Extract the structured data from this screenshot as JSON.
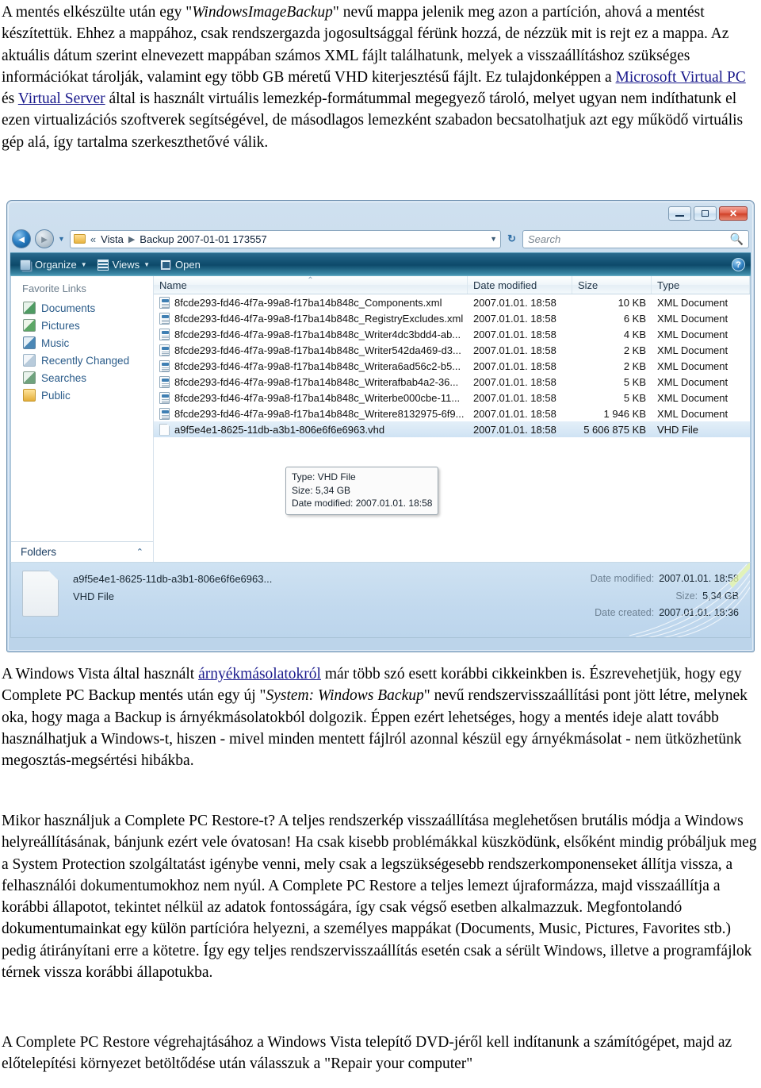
{
  "article": {
    "para1_parts": [
      {
        "t": "A mentés elkészülte után egy \"",
        "s": "n"
      },
      {
        "t": "WindowsImageBackup",
        "s": "i"
      },
      {
        "t": "\" nevű mappa jelenik meg azon a partíción, ahová a mentést készítettük. Ehhez a mappához, csak rendszergazda jogosultsággal férünk hozzá, de nézzük mit is rejt ez a mappa. Az aktuális dátum szerint elnevezett mappában számos XML fájlt találhatunk, melyek a visszaállításhoz szükséges információkat tárolják, valamint egy több GB méretű VHD kiterjesztésű fájlt. Ez tulajdonképpen a ",
        "s": "n"
      },
      {
        "t": "Microsoft Virtual PC",
        "s": "a"
      },
      {
        "t": " és ",
        "s": "n"
      },
      {
        "t": "Virtual Server",
        "s": "a"
      },
      {
        "t": " által is használt virtuális lemezkép-formátummal megegyező tároló, melyet ugyan nem indíthatunk el ezen virtualizációs szoftverek segítségével, de másodlagos lemezként szabadon becsatolhatjuk azt egy működő virtuális gép alá, így tartalma szerkeszthetővé válik.",
        "s": "n"
      }
    ],
    "para2_parts": [
      {
        "t": "A Windows Vista által használt ",
        "s": "n"
      },
      {
        "t": "árnyékmásolatokról",
        "s": "a"
      },
      {
        "t": " már több szó esett korábbi cikkeinkben is. Észrevehetjük, hogy egy Complete PC Backup mentés után egy új \"",
        "s": "n"
      },
      {
        "t": "System: Windows Backup",
        "s": "i"
      },
      {
        "t": "\" nevű rendszervisszaállítási pont jött létre, melynek oka, hogy maga a Backup is árnyékmásolatokból dolgozik. Éppen ezért lehetséges, hogy a mentés ideje alatt tovább használhatjuk a Windows-t, hiszen - mivel minden mentett fájlról azonnal készül egy árnyékmásolat - nem ütközhetünk megosztás-megsértési hibákba.",
        "s": "n"
      }
    ],
    "para3": "Mikor használjuk a Complete PC Restore-t? A teljes rendszerkép visszaállítása meglehetősen brutális módja a Windows helyreállításának, bánjunk ezért vele óvatosan! Ha csak kisebb problémákkal küszködünk, elsőként mindig próbáljuk meg a System Protection szolgáltatást igénybe venni, mely csak a legszükségesebb rendszerkomponenseket állítja vissza, a felhasználói dokumentumokhoz nem nyúl. A Complete PC Restore a teljes lemezt újraformázza, majd visszaállítja a korábbi állapotot, tekintet nélkül az adatok fontosságára, így csak végső esetben alkalmazzuk. Megfontolandó dokumentumainkat egy külön partícióra helyezni, a személyes mappákat (Documents, Music, Pictures, Favorites stb.) pedig átirányítani erre a kötetre. Így egy teljes rendszervisszaállítás esetén csak a sérült Windows, illetve a programfájlok térnek vissza korábbi állapotukba.",
    "para4": "A Complete PC Restore végrehajtásához a Windows Vista telepítő DVD-jéről kell indítanunk a számítógépet, majd az előtelepítési környezet betöltődése után válasszuk a \"Repair your computer\""
  },
  "explorer": {
    "window_buttons": {
      "minimize": "minimize-icon",
      "maximize": "maximize-icon",
      "close": "✕"
    },
    "nav": {
      "back": "◄",
      "forward": "►",
      "history_caret": "▼"
    },
    "address": {
      "folder_icon": "folder-icon",
      "overflow": "«",
      "crumbs": [
        "Vista",
        "Backup 2007-01-01 173557"
      ],
      "separator": "▶",
      "dropdown_caret": "▼",
      "refresh_icon": "↻"
    },
    "search": {
      "placeholder": "Search",
      "icon": "🔍"
    },
    "toolbar": {
      "organize": "Organize",
      "views": "Views",
      "open": "Open",
      "caret": "▼",
      "help": "?"
    },
    "nav_pane": {
      "title": "Favorite Links",
      "items": [
        {
          "label": "Documents",
          "icon": "documents-icon"
        },
        {
          "label": "Pictures",
          "icon": "pictures-icon"
        },
        {
          "label": "Music",
          "icon": "music-icon"
        },
        {
          "label": "Recently Changed",
          "icon": "recently-changed-icon"
        },
        {
          "label": "Searches",
          "icon": "searches-icon"
        },
        {
          "label": "Public",
          "icon": "public-folder-icon"
        }
      ],
      "folders_label": "Folders",
      "folders_chevron": "⌃"
    },
    "columns": [
      "Name",
      "Date modified",
      "Size",
      "Type"
    ],
    "sort_indicator": "⌃",
    "files": [
      {
        "name": "8fcde293-fd46-4f7a-99a8-f17ba14b848c_Components.xml",
        "date": "2007.01.01. 18:58",
        "size": "10 KB",
        "type": "XML Document",
        "icon": "xml-file-icon",
        "selected": false
      },
      {
        "name": "8fcde293-fd46-4f7a-99a8-f17ba14b848c_RegistryExcludes.xml",
        "date": "2007.01.01. 18:58",
        "size": "6 KB",
        "type": "XML Document",
        "icon": "xml-file-icon",
        "selected": false
      },
      {
        "name": "8fcde293-fd46-4f7a-99a8-f17ba14b848c_Writer4dc3bdd4-ab...",
        "date": "2007.01.01. 18:58",
        "size": "4 KB",
        "type": "XML Document",
        "icon": "xml-file-icon",
        "selected": false
      },
      {
        "name": "8fcde293-fd46-4f7a-99a8-f17ba14b848c_Writer542da469-d3...",
        "date": "2007.01.01. 18:58",
        "size": "2 KB",
        "type": "XML Document",
        "icon": "xml-file-icon",
        "selected": false
      },
      {
        "name": "8fcde293-fd46-4f7a-99a8-f17ba14b848c_Writera6ad56c2-b5...",
        "date": "2007.01.01. 18:58",
        "size": "2 KB",
        "type": "XML Document",
        "icon": "xml-file-icon",
        "selected": false
      },
      {
        "name": "8fcde293-fd46-4f7a-99a8-f17ba14b848c_Writerafbab4a2-36...",
        "date": "2007.01.01. 18:58",
        "size": "5 KB",
        "type": "XML Document",
        "icon": "xml-file-icon",
        "selected": false
      },
      {
        "name": "8fcde293-fd46-4f7a-99a8-f17ba14b848c_Writerbe000cbe-11...",
        "date": "2007.01.01. 18:58",
        "size": "5 KB",
        "type": "XML Document",
        "icon": "xml-file-icon",
        "selected": false
      },
      {
        "name": "8fcde293-fd46-4f7a-99a8-f17ba14b848c_Writere8132975-6f9...",
        "date": "2007.01.01. 18:58",
        "size": "1 946 KB",
        "type": "XML Document",
        "icon": "xml-file-icon",
        "selected": false
      },
      {
        "name": "a9f5e4e1-8625-11db-a3b1-806e6f6e6963.vhd",
        "date": "2007.01.01. 18:58",
        "size": "5 606 875 KB",
        "type": "VHD File",
        "icon": "vhd-file-icon",
        "selected": true
      }
    ],
    "tooltip": {
      "line1": "Type: VHD File",
      "line2": "Size: 5,34 GB",
      "line3": "Date modified: 2007.01.01. 18:58"
    },
    "details_pane": {
      "file_name": "a9f5e4e1-8625-11db-a3b1-806e6f6e6963...",
      "file_type": "VHD File",
      "date_modified_key": "Date modified:",
      "date_modified_value": "2007.01.01. 18:58",
      "size_key": "Size:",
      "size_value": "5,34 GB",
      "date_created_key": "Date created:",
      "date_created_value": "2007.01.01. 18:36"
    }
  },
  "colors": {
    "link": "#1a1a8c",
    "glass": "#c3d8ec",
    "toolbar": "#0d4a6a",
    "nav_link": "#2b5c8a",
    "selection": "#cfe3f4",
    "close_button": "#cf3f26"
  }
}
